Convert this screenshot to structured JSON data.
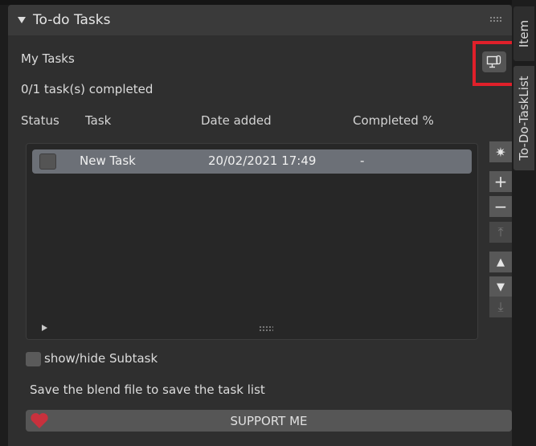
{
  "panel": {
    "title": "To-do Tasks",
    "section_label": "My Tasks",
    "completion_summary": "0/1 task(s) completed"
  },
  "columns": {
    "status": "Status",
    "task": "Task",
    "date_added": "Date added",
    "completed": "Completed %"
  },
  "tasks": [
    {
      "name": "New Task",
      "date_added": "20/02/2021 17:49",
      "completed": "-",
      "checked": false
    }
  ],
  "side_buttons": [
    {
      "icon": "sparkle-icon",
      "glyph": "✷"
    },
    {
      "icon": "plus-icon",
      "glyph": "+"
    },
    {
      "icon": "minus-icon",
      "glyph": "−"
    },
    {
      "icon": "move-top-icon",
      "glyph": "⤒"
    },
    {
      "icon": "move-up-icon",
      "glyph": "▲"
    },
    {
      "icon": "move-down-icon",
      "glyph": "▼"
    },
    {
      "icon": "move-bottom-icon",
      "glyph": "⤓"
    }
  ],
  "options": {
    "subtask_toggle_label": "show/hide Subtask"
  },
  "footer": {
    "save_hint": "Save the blend file to save the task list",
    "support_label": "SUPPORT ME"
  },
  "sidebar_tabs": [
    "Item",
    "To-Do-TaskList"
  ],
  "colors": {
    "highlight": "#e0202a",
    "heart": "#c8313d",
    "selected_row": "#6c7077"
  }
}
